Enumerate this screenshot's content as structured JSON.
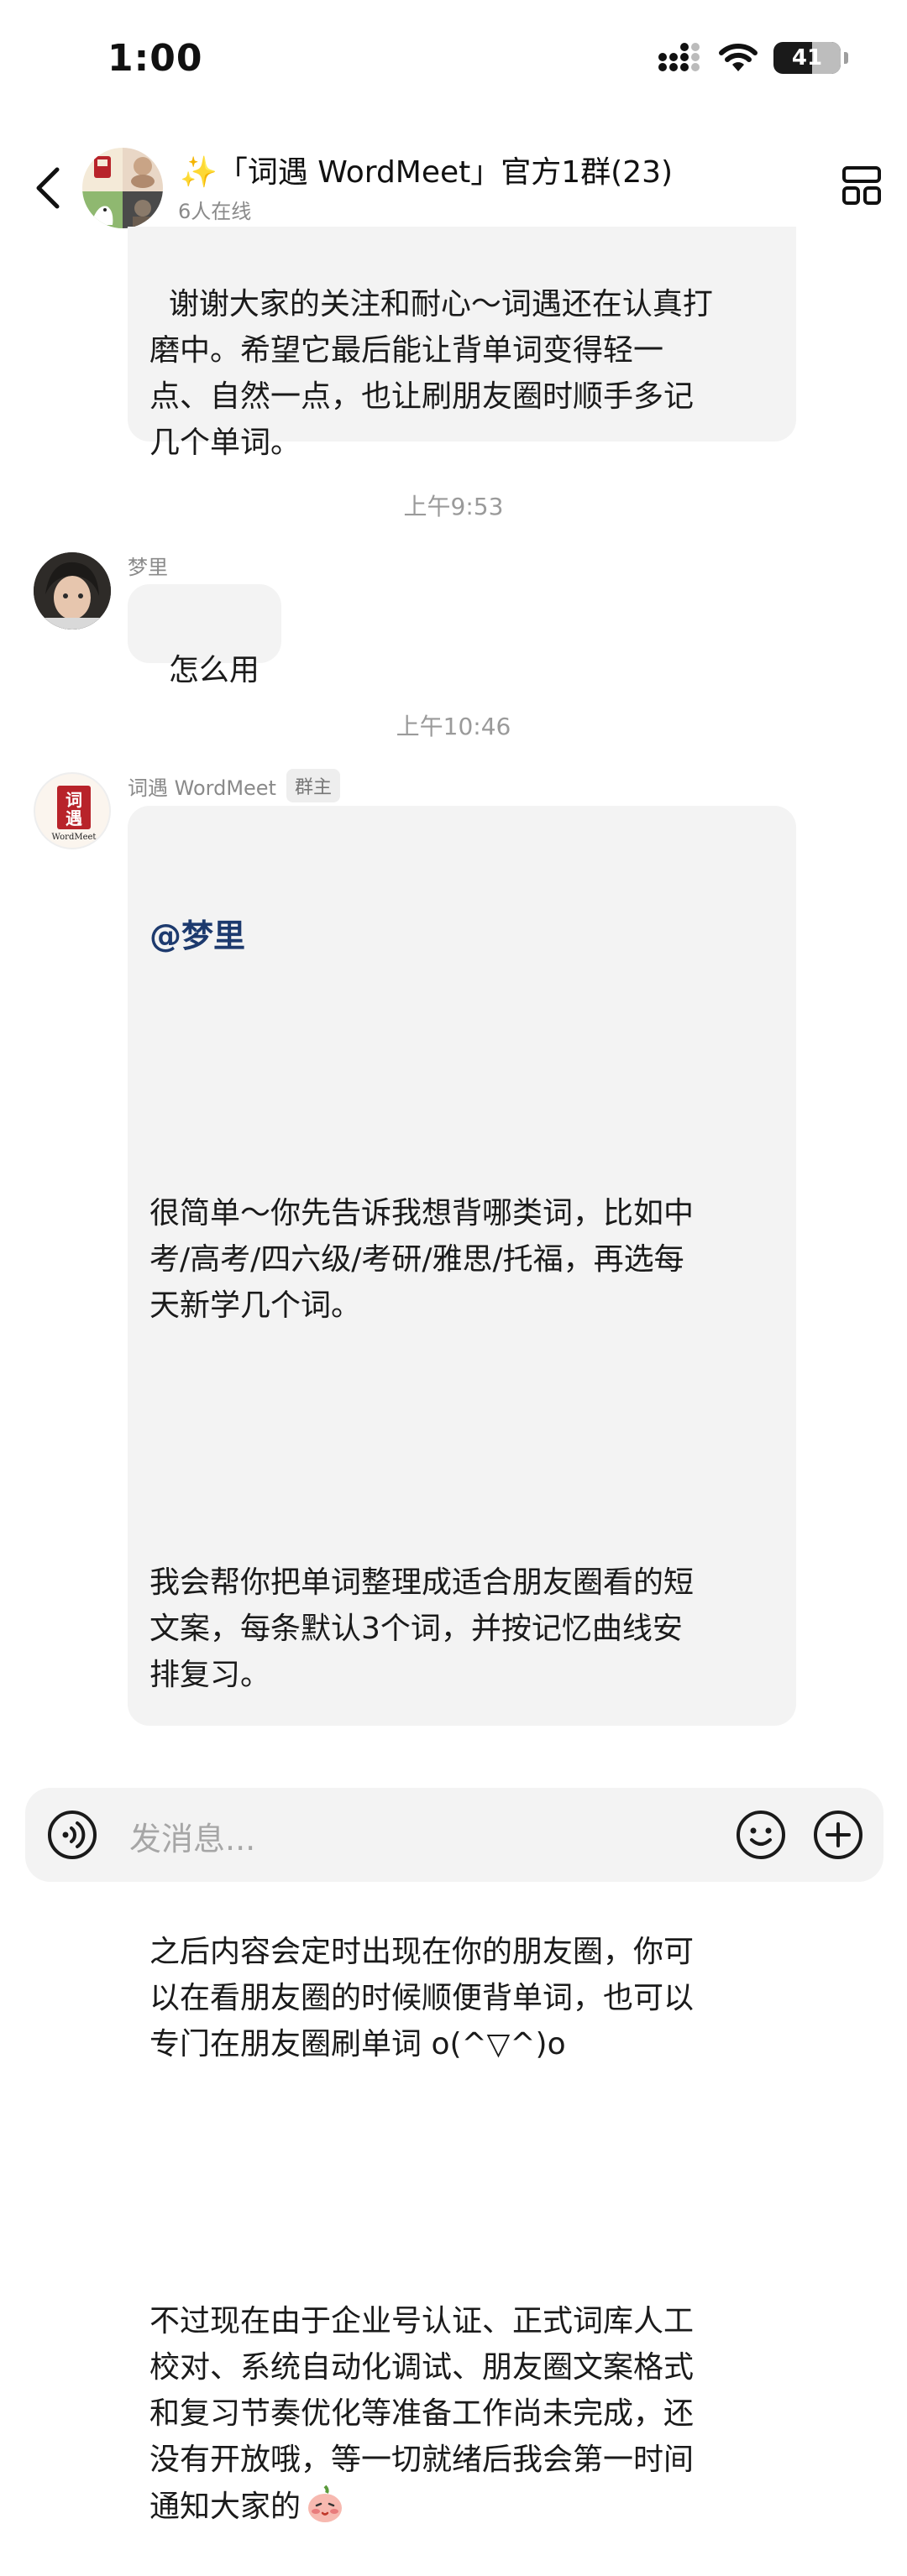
{
  "status_bar": {
    "time": "1:00",
    "battery": "41"
  },
  "header": {
    "title": "✨「词遇 WordMeet」官方1群(23)",
    "online": "6人在线"
  },
  "messages": {
    "first_bubble": "谢谢大家的关注和耐心～词遇还在认真打\n磨中。希望它最后能让背单词变得轻一\n点、自然一点，也让刷朋友圈时顺手多记\n几个单词。",
    "ts1": "上午9:53",
    "sender1": "梦里",
    "msg1": "怎么用",
    "ts2": "上午10:46",
    "sender2": "词遇 WordMeet",
    "sender2_badge": "群主",
    "mention": "@梦里",
    "p1": "很简单～你先告诉我想背哪类词，比如中\n考/高考/四六级/考研/雅思/托福，再选每\n天新学几个词。",
    "p2": "我会帮你把单词整理成适合朋友圈看的短\n文案，每条默认3个词，并按记忆曲线安\n排复习。",
    "p3": "之后内容会定时出现在你的朋友圈，你可\n以在看朋友圈的时候顺便背单词，也可以\n专门在朋友圈刷单词 o(^▽^)o",
    "p4": "不过现在由于企业号认证、正式词库人工\n校对、系统自动化调试、朋友圈文案格式\n和复习节奏优化等准备工作尚未完成，还\n没有开放哦，等一切就绪后我会第一时间\n通知大家的",
    "logo_text_top": "词",
    "logo_text_bottom": "遇",
    "logo_caption": "WordMeet"
  },
  "input": {
    "placeholder": "发消息..."
  },
  "icons": [
    "signal-icon",
    "wifi-icon",
    "battery-icon",
    "back-icon",
    "layout-icon",
    "voice-icon",
    "emoji-icon",
    "plus-icon",
    "blush-emoji-icon"
  ]
}
